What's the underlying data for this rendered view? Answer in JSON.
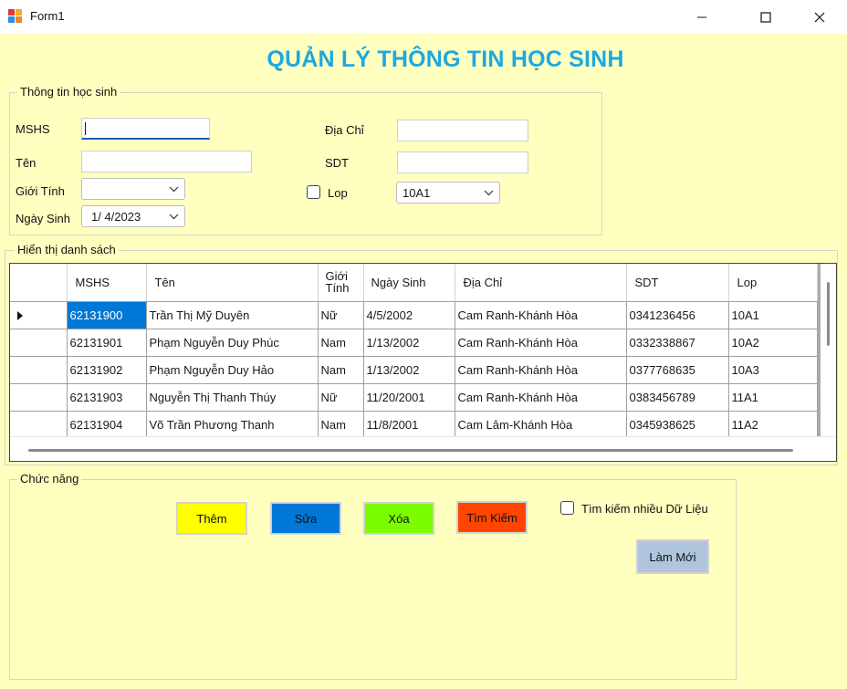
{
  "window": {
    "title": "Form1"
  },
  "heading": "QUẢN LÝ THÔNG TIN HỌC SINH",
  "info_group": {
    "title": "Thông tin học sinh",
    "mshs_label": "MSHS",
    "mshs_value": "",
    "ten_label": "Tên",
    "ten_value": "",
    "gioitinh_label": "Giới Tính",
    "gioitinh_value": "",
    "ngaysinh_label": "Ngày Sinh",
    "ngaysinh_value": "1/  4/2023",
    "diachi_label": "Địa Chỉ",
    "diachi_value": "",
    "sdt_label": "SDT",
    "sdt_value": "",
    "lop_checkbox_label": "Lop",
    "lop_value": "10A1"
  },
  "list_group": {
    "title": "Hiển thị danh sách",
    "columns": [
      "MSHS",
      "Tên",
      "Giới Tính",
      "Ngày Sinh",
      "Địa Chỉ",
      "SDT",
      "Lop"
    ],
    "rows": [
      [
        "62131900",
        "Trần Thị Mỹ Duyên",
        "Nữ",
        "4/5/2002",
        "Cam Ranh-Khánh Hòa",
        "0341236456",
        "10A1"
      ],
      [
        "62131901",
        "Phạm Nguyễn Duy Phúc",
        "Nam",
        "1/13/2002",
        "Cam Ranh-Khánh Hòa",
        "0332338867",
        "10A2"
      ],
      [
        "62131902",
        "Phạm Nguyễn Duy Hảo",
        "Nam",
        "1/13/2002",
        "Cam Ranh-Khánh Hòa",
        "0377768635",
        "10A3"
      ],
      [
        "62131903",
        "Nguyễn Thị Thanh Thúy",
        "Nữ",
        "11/20/2001",
        "Cam Ranh-Khánh Hòa",
        "0383456789",
        "11A1"
      ],
      [
        "62131904",
        "Võ Trần Phương Thanh",
        "Nam",
        "11/8/2001",
        "Cam Lâm-Khánh Hòa",
        "0345938625",
        "11A2"
      ]
    ]
  },
  "actions_group": {
    "title": "Chức năng",
    "them_label": "Thêm",
    "sua_label": "Sửa",
    "xoa_label": "Xóa",
    "timkiem_label": "Tìm Kiếm",
    "multi_search_label": "Tìm kiếm nhiều Dữ Liệu",
    "lammoi_label": "Làm Mới"
  },
  "colors": {
    "form_background": "#ffffc0",
    "heading": "#1ea8e0",
    "them_button": "#ffff00",
    "sua_button": "#0078d7",
    "xoa_button": "#7cfc00",
    "timkiem_button": "#ff4500",
    "lammoi_button": "#b0c4de",
    "selected_cell": "#0078d7"
  },
  "icons": {
    "app": "windows-form-icon",
    "minimize": "minimize-icon",
    "maximize": "maximize-icon",
    "close": "close-icon",
    "dropdown": "chevron-down-icon",
    "row_pointer": "row-pointer-icon"
  }
}
